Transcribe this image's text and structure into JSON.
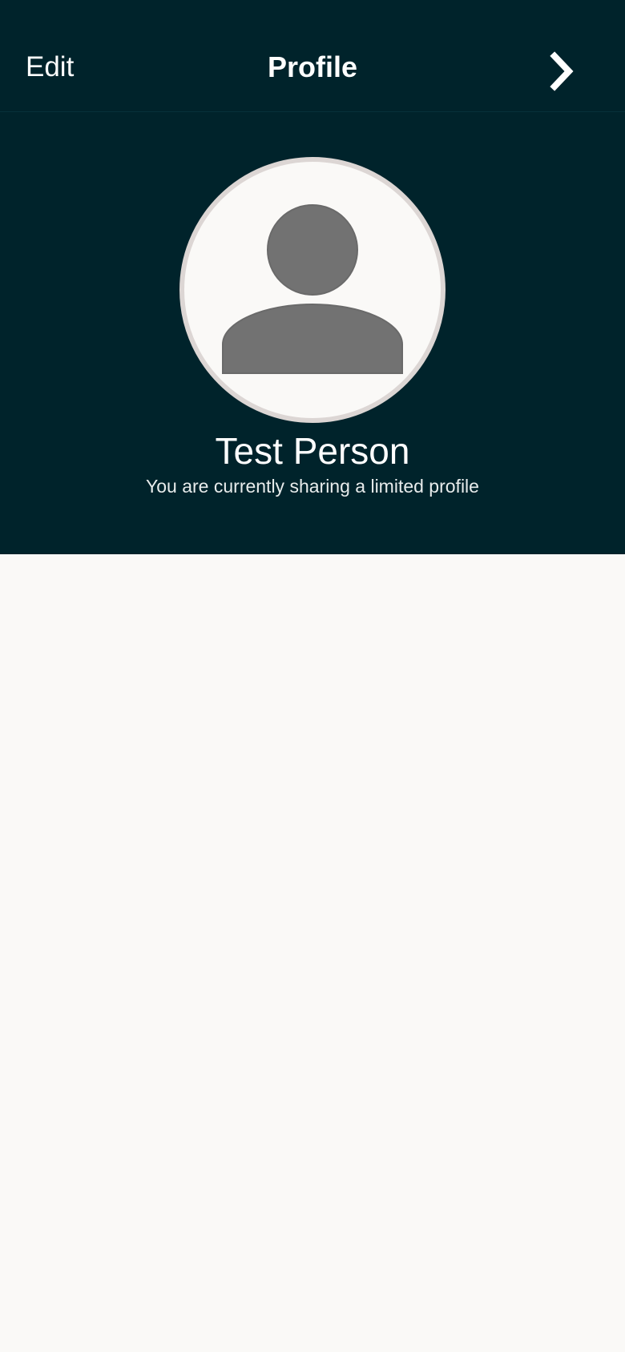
{
  "nav": {
    "edit_label": "Edit",
    "title": "Profile",
    "next_icon": "chevron-right-icon"
  },
  "profile": {
    "avatar_icon": "person-placeholder-icon",
    "name": "Test Person",
    "sharing_status": "You are currently sharing a limited profile"
  },
  "colors": {
    "header_background": "#00232b",
    "page_background": "#faf9f7",
    "avatar_border": "#dcd6d4",
    "avatar_silhouette": "#727272",
    "text_primary": "#ffffff"
  }
}
